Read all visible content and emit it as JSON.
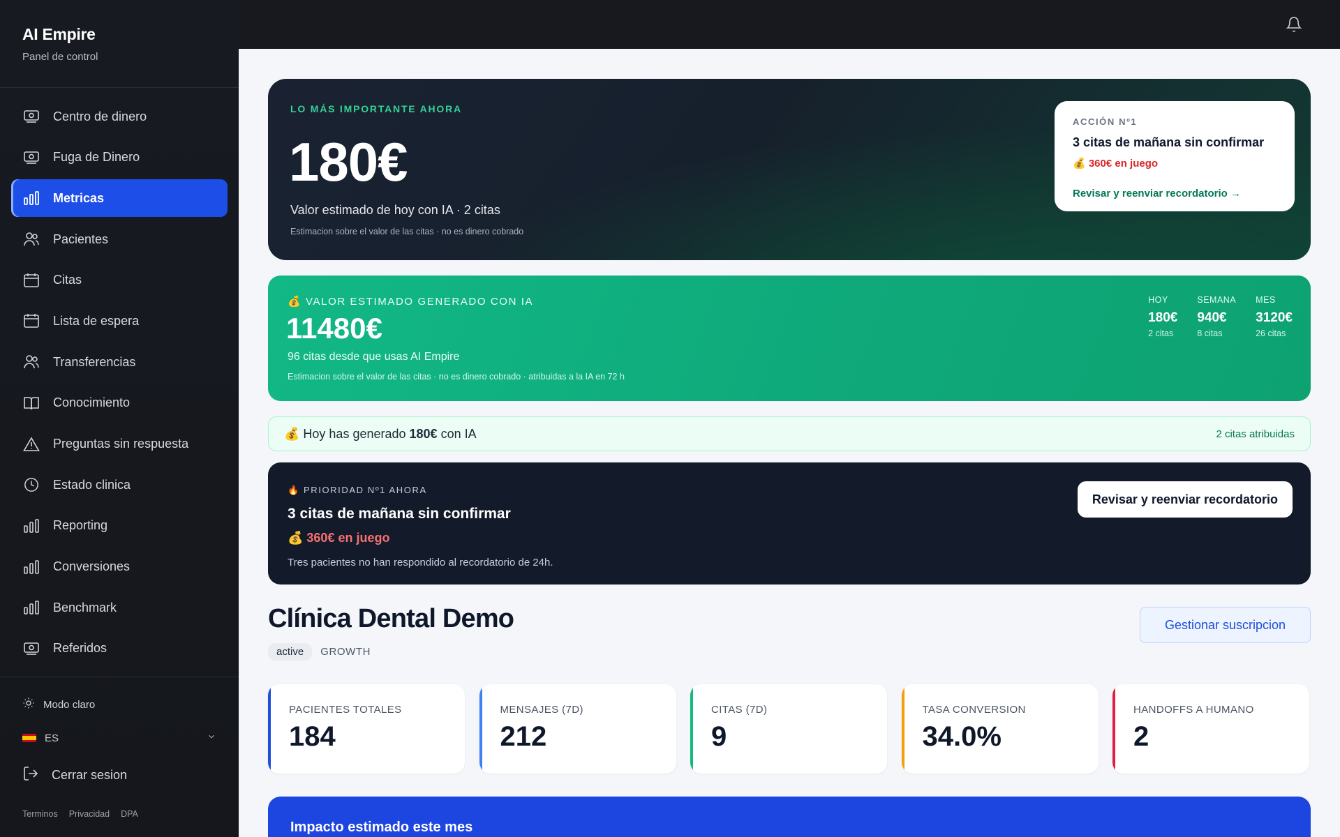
{
  "brand": {
    "title": "AI Empire",
    "subtitle": "Panel de control"
  },
  "sidebar": {
    "items": [
      {
        "label": "Centro de dinero",
        "icon": "money-icon"
      },
      {
        "label": "Fuga de Dinero",
        "icon": "money-icon"
      },
      {
        "label": "Metricas",
        "icon": "bar-chart-icon",
        "active": true
      },
      {
        "label": "Pacientes",
        "icon": "users-icon"
      },
      {
        "label": "Citas",
        "icon": "calendar-icon"
      },
      {
        "label": "Lista de espera",
        "icon": "calendar-icon"
      },
      {
        "label": "Transferencias",
        "icon": "users-icon"
      },
      {
        "label": "Conocimiento",
        "icon": "book-icon"
      },
      {
        "label": "Preguntas sin respuesta",
        "icon": "warning-icon"
      },
      {
        "label": "Estado clinica",
        "icon": "clock-icon"
      },
      {
        "label": "Reporting",
        "icon": "bar-chart-icon"
      },
      {
        "label": "Conversiones",
        "icon": "bar-chart-icon"
      },
      {
        "label": "Benchmark",
        "icon": "bar-chart-icon"
      },
      {
        "label": "Referidos",
        "icon": "money-icon"
      }
    ],
    "mode_label": "Modo claro",
    "language": "ES",
    "logout_label": "Cerrar sesion",
    "legal": [
      "Terminos",
      "Privacidad",
      "DPA"
    ]
  },
  "hero": {
    "kicker": "LO MÁS IMPORTANTE AHORA",
    "value": "180€",
    "description": "Valor estimado de hoy con IA · 2 citas",
    "note": "Estimacion sobre el valor de las citas · no es dinero cobrado",
    "action": {
      "kicker": "ACCIÓN Nº1",
      "title": "3 citas de mañana sin confirmar",
      "stake": "💰 360€ en juego",
      "link": "Revisar y reenviar recordatorio →"
    }
  },
  "generated": {
    "kicker": "💰 VALOR ESTIMADO GENERADO CON IA",
    "value": "11480€",
    "description": "96 citas desde que usas AI Empire",
    "note": "Estimacion sobre el valor de las citas · no es dinero cobrado · atribuidas a la IA en 72 h",
    "stats": [
      {
        "label": "HOY",
        "value": "180€",
        "sub": "2 citas"
      },
      {
        "label": "SEMANA",
        "value": "940€",
        "sub": "8 citas"
      },
      {
        "label": "MES",
        "value": "3120€",
        "sub": "26 citas"
      }
    ]
  },
  "today": {
    "prefix": "💰 Hoy has generado",
    "amount": "180€",
    "suffix": "con IA",
    "attributed": "2 citas atribuidas"
  },
  "priority": {
    "kicker": "🔥 PRIORIDAD Nº1 AHORA",
    "title": "3 citas de mañana sin confirmar",
    "stake": "💰 360€ en juego",
    "description": "Tres pacientes no han respondido al recordatorio de 24h.",
    "button": "Revisar y reenviar recordatorio"
  },
  "clinic": {
    "name": "Clínica Dental Demo",
    "status": "active",
    "plan": "GROWTH",
    "manage_button": "Gestionar suscripcion"
  },
  "kpis": [
    {
      "label": "PACIENTES TOTALES",
      "value": "184",
      "accent": "#1d4ed8"
    },
    {
      "label": "MENSAJES (7D)",
      "value": "212",
      "accent": "#3b82f6"
    },
    {
      "label": "CITAS (7D)",
      "value": "9",
      "accent": "#10b981"
    },
    {
      "label": "TASA CONVERSION",
      "value": "34.0%",
      "accent": "#f59e0b"
    },
    {
      "label": "HANDOFFS A HUMANO",
      "value": "2",
      "accent": "#e11d48"
    }
  ],
  "impact": {
    "title": "Impacto estimado este mes"
  }
}
